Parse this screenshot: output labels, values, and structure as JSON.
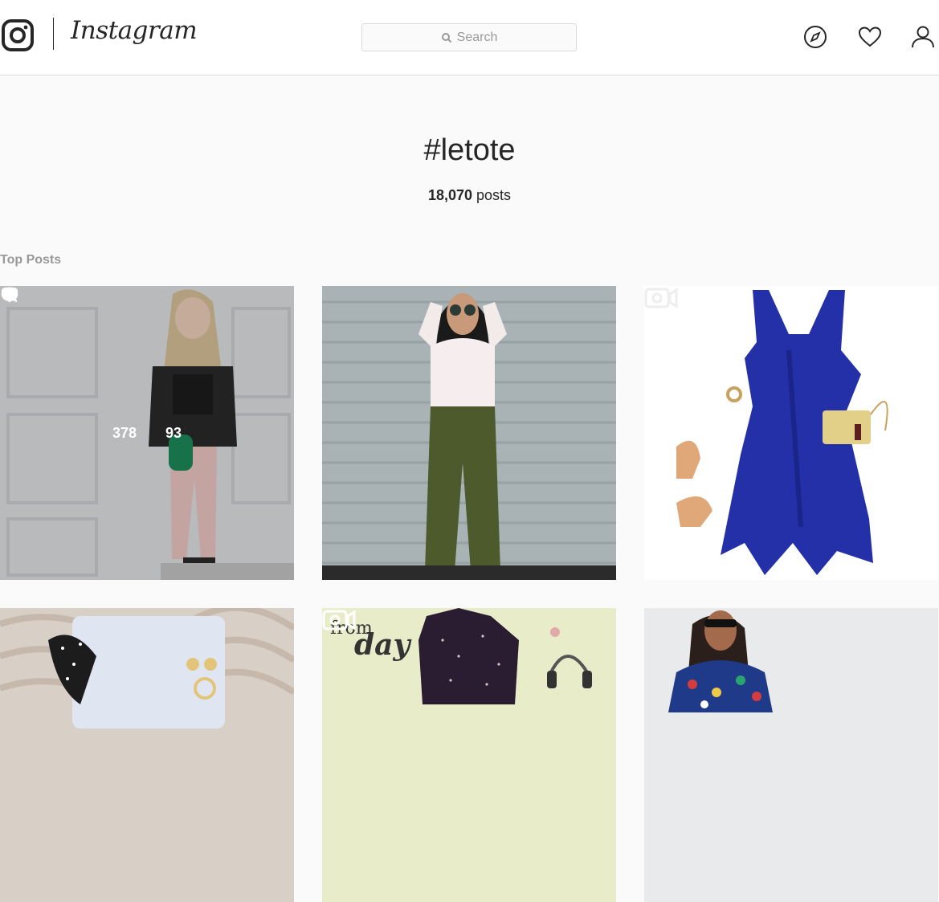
{
  "header": {
    "wordmark": "Instagram",
    "search_placeholder": "Search"
  },
  "hashtag": {
    "title": "#letote",
    "post_count": "18,070",
    "post_suffix": "posts"
  },
  "section": {
    "label": "Top Posts"
  },
  "posts": [
    {
      "likes": "378",
      "comments": "93",
      "hovered": true,
      "video": false
    },
    {
      "video": false
    },
    {
      "video": true
    },
    {
      "video": false
    },
    {
      "video": true,
      "caption_small": "from",
      "caption_large": "day"
    },
    {
      "video": false
    }
  ],
  "colors": {
    "accent": "#262626",
    "muted": "#999999",
    "border": "#dbdbdb"
  }
}
